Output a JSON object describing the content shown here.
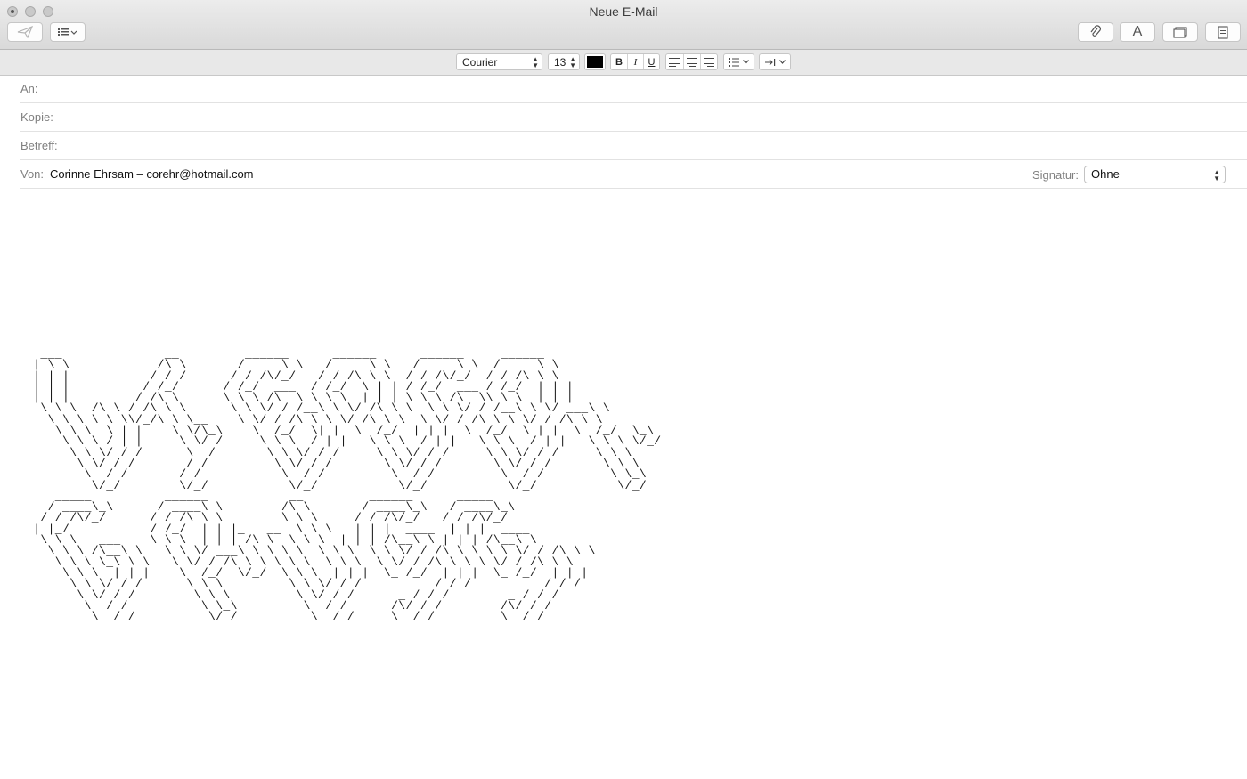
{
  "window": {
    "title": "Neue E-Mail"
  },
  "toolbar": {
    "send_icon": "paper-plane-icon",
    "list_icon": "list-icon",
    "attach_icon": "paperclip-icon",
    "font_glyph": "A",
    "photo_icon": "photo-browser-icon",
    "template_icon": "stationery-icon"
  },
  "format": {
    "font": "Courier",
    "size": "13",
    "color": "#000000",
    "bold": "B",
    "italic": "I",
    "underline": "U"
  },
  "headers": {
    "to_label": "An:",
    "cc_label": "Kopie:",
    "subject_label": "Betreff:",
    "from_label": "Von:",
    "from_value": "Corinne Ehrsam – corehr@hotmail.com",
    "signature_label": "Signatur:",
    "signature_value": "Ohne"
  },
  "body": {
    "ascii_art": "  ___              __         ______      ______      ______     ______\n | \\_\\            /\\_\\       / ____\\_\\   / ____\\ \\   / ____\\_\\  / ____\\ \\\n | | |           / / /      / / /\\/_/   / / /\\ \\ \\  / / /\\/_/  / / /\\ \\ \\\n | | |          / /_/      / /_/  ___  / /_/  \\ | | / /_/  ___ / /_/  | | |\n | | |    __   / /\\ \\      \\ \\ \\ /\\__\\ \\ \\ \\  | | | \\ \\ \\ /\\__\\\\ \\ \\  | | |_\n  \\ \\ \\  /\\ \\ / /\\ \\ \\      \\ \\ \\/ / /__\\ \\ \\/ /\\ \\ \\  \\ \\ \\/ / /__\\ \\ \\/ ___\\ \\\n   \\ \\ \\ \\ \\ \\\\/_/\\ \\ \\__    \\ \\/ / /\\ \\ \\ \\/ /\\ \\ \\  \\ \\/ / /\\ \\ \\ \\/ / /\\ \\ \\\n    \\ \\ \\  \\ | |    \\ \\/\\_\\    \\  /_/  \\| |  \\  /_/  | | |  \\  /_/  \\ | |  \\  /_/  \\_\\\n     \\ \\ \\ / | |     \\ \\/ /     \\ \\ \\  / | |   \\ \\ \\  / | |   \\ \\ \\  / | |   \\ \\ \\ \\/_/\n      \\ \\ \\/ / /      \\  /       \\ \\ \\/ / /     \\ \\ \\/ / /     \\ \\ \\/ / /     \\ \\ \\\n       \\ \\/ / /       / /         \\ \\/ / /       \\ \\/ / /       \\ \\/ / /       \\ \\ \\\n        \\  / /       / /           \\  / /         \\  / /         \\  / /         \\ \\_\\\n         \\/_/        \\/_/           \\/_/           \\/_/           \\/_/           \\/_/\n    _____          ______           __         ______      _____\n   / ____\\_\\      / ____\\ \\        /\\ \\       / ____\\_\\   / ____\\_\\\n  / / /\\/_/      / / /\\ \\ \\        \\ \\ \\     / / /\\/_/   / / /\\/_/\n | |_/           / /_/  | | |_   __  \\ \\ \\   | | |  ____  | | |  ____\n  \\ \\ \\   ___    \\ \\ \\  | | | /\\ \\  \\ \\ \\  | | | /\\__\\ \\ | | | /\\__\\ \\\n   \\ \\ \\ /\\__\\ \\   \\ \\ \\/ ___\\ \\ \\ \\ \\  \\ \\ \\  \\ \\ \\/ / /\\ \\ \\ \\ \\ \\/ / /\\ \\ \\\n    \\ \\ \\ \\_\\ \\ \\   \\ \\/ / /\\ \\ \\ \\ \\ \\  \\ \\ \\  \\ \\/ / /\\ \\ \\ \\ \\/ / /\\ \\ \\\n     \\ \\ \\  | | |    \\  /_/  \\/_/  \\ \\ \\  | | |  \\_ /_/  | | |  \\_ /_/  | | |\n      \\ \\ \\/ / /      \\ \\ \\         \\ \\ \\/ / /          / / /          / / /\n       \\ \\/ / /        \\ \\ \\         \\ \\/ / /      _ / / /        _ / / /\n        \\  / /          \\ \\_\\         \\  / /      /\\/ / /        /\\/ / /\n         \\__/_/          \\/_/          \\__/_/     \\__/_/         \\__/_/"
  }
}
